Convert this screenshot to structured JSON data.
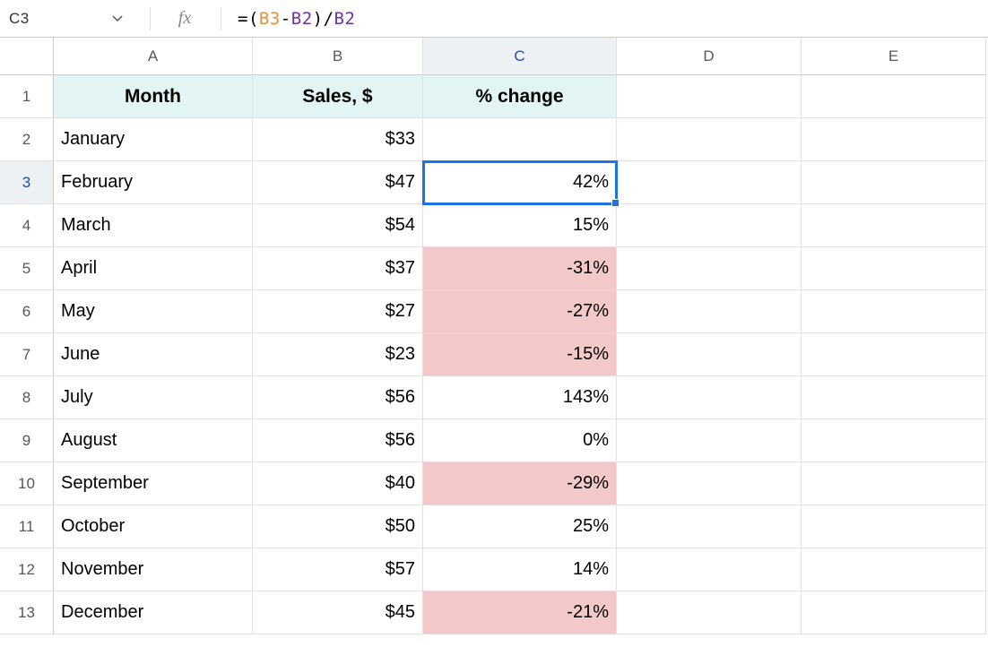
{
  "nameBox": "C3",
  "formulaParts": {
    "eq": "=",
    "lp": "(",
    "ref1": "B3",
    "minus": "-",
    "ref2a": "B2",
    "rp": ")",
    "slash": "/",
    "ref2b": "B2"
  },
  "colHeaders": [
    "A",
    "B",
    "C",
    "D",
    "E"
  ],
  "rowHeaders": [
    "1",
    "2",
    "3",
    "4",
    "5",
    "6",
    "7",
    "8",
    "9",
    "10",
    "11",
    "12",
    "13"
  ],
  "tableHeaders": {
    "a": "Month",
    "b": "Sales, $",
    "c": "% change"
  },
  "rows": [
    {
      "month": "January",
      "sales": "$33",
      "pct": "",
      "neg": false
    },
    {
      "month": "February",
      "sales": "$47",
      "pct": "42%",
      "neg": false
    },
    {
      "month": "March",
      "sales": "$54",
      "pct": "15%",
      "neg": false
    },
    {
      "month": "April",
      "sales": "$37",
      "pct": "-31%",
      "neg": true
    },
    {
      "month": "May",
      "sales": "$27",
      "pct": "-27%",
      "neg": true
    },
    {
      "month": "June",
      "sales": "$23",
      "pct": "-15%",
      "neg": true
    },
    {
      "month": "July",
      "sales": "$56",
      "pct": "143%",
      "neg": false
    },
    {
      "month": "August",
      "sales": "$56",
      "pct": "0%",
      "neg": false
    },
    {
      "month": "September",
      "sales": "$40",
      "pct": "-29%",
      "neg": true
    },
    {
      "month": "October",
      "sales": "$50",
      "pct": "25%",
      "neg": false
    },
    {
      "month": "November",
      "sales": "$57",
      "pct": "14%",
      "neg": false
    },
    {
      "month": "December",
      "sales": "$45",
      "pct": "-21%",
      "neg": true
    }
  ],
  "selected": {
    "row": 3,
    "col": "C"
  }
}
